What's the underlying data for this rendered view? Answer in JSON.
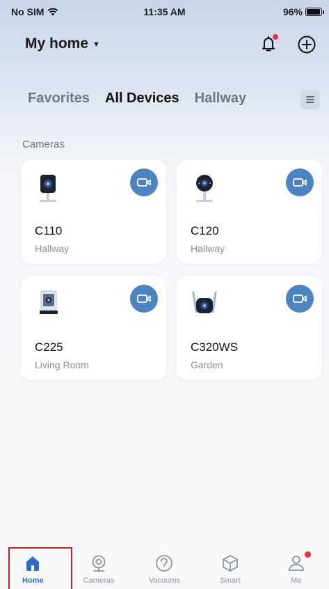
{
  "status_bar": {
    "carrier": "No SIM",
    "time": "11:35 AM",
    "battery": "96%",
    "battery_level": 0.96
  },
  "header": {
    "home_name": "My home",
    "notification_dot": true
  },
  "tabs": [
    {
      "label": "Favorites",
      "active": false
    },
    {
      "label": "All Devices",
      "active": true
    },
    {
      "label": "Hallway",
      "active": false
    }
  ],
  "section": {
    "label": "Cameras"
  },
  "devices": [
    {
      "name": "C110",
      "room": "Hallway",
      "icon": "camera-c110-icon"
    },
    {
      "name": "C120",
      "room": "Hallway",
      "icon": "camera-c120-icon"
    },
    {
      "name": "C225",
      "room": "Living Room",
      "icon": "camera-c225-icon"
    },
    {
      "name": "C320WS",
      "room": "Garden",
      "icon": "camera-c320ws-icon"
    }
  ],
  "nav": [
    {
      "label": "Home",
      "icon": "home-icon",
      "active": true
    },
    {
      "label": "Cameras",
      "icon": "camera-icon",
      "active": false
    },
    {
      "label": "Vacuums",
      "icon": "vacuum-icon",
      "active": false
    },
    {
      "label": "Smart",
      "icon": "cube-icon",
      "active": false
    },
    {
      "label": "Me",
      "icon": "person-icon",
      "active": false,
      "badge": true
    }
  ],
  "colors": {
    "accent": "#4c84c2",
    "active_nav": "#2f6fc0",
    "badge": "#e8323c"
  }
}
